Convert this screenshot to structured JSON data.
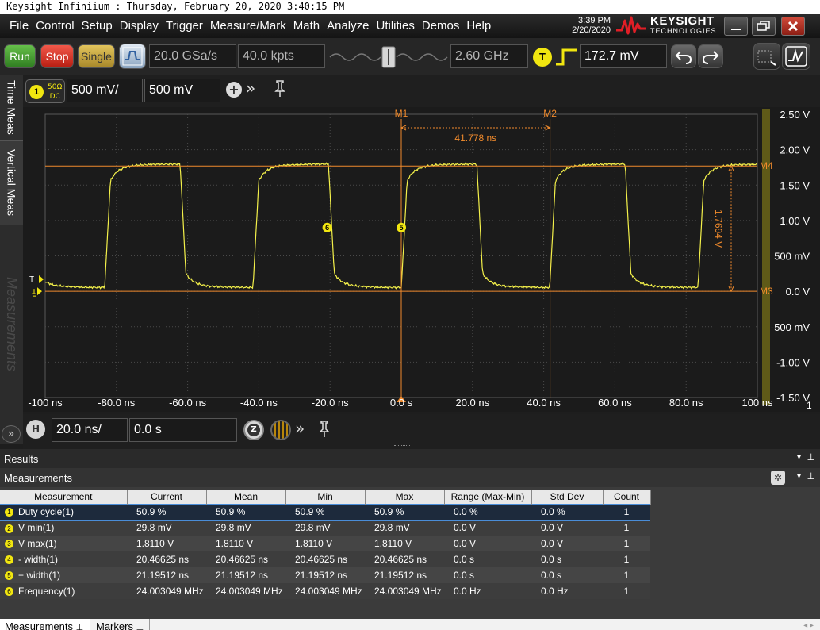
{
  "window_title": "Keysight Infiniium : Thursday, February 20, 2020 3:40:15 PM",
  "menu": [
    "File",
    "Control",
    "Setup",
    "Display",
    "Trigger",
    "Measure/Mark",
    "Math",
    "Analyze",
    "Utilities",
    "Demos",
    "Help"
  ],
  "clock": {
    "time": "3:39 PM",
    "date": "2/20/2020"
  },
  "brand": {
    "name": "KEYSIGHT",
    "sub": "TECHNOLOGIES"
  },
  "toolbar": {
    "run": "Run",
    "stop": "Stop",
    "single": "Single",
    "sample_rate": "20.0 GSa/s",
    "memory_depth": "40.0 kpts",
    "bandwidth": "2.60 GHz",
    "trigger_badge": "T",
    "trigger_level": "172.7 mV"
  },
  "side_tabs": [
    "Time Meas",
    "Vertical Meas",
    "Measurements"
  ],
  "channel": {
    "number": "1",
    "coupling_top": "50Ω",
    "coupling_bottom": "DC",
    "scale": "500 mV/",
    "offset": "500 mV"
  },
  "horizontal": {
    "badge": "H",
    "scale": "20.0 ns/",
    "position": "0.0 s",
    "zoom_badge": "Z"
  },
  "colors": {
    "trace": "#f3f04a",
    "marker": "#f08a2c",
    "grid": "#4a4a4a",
    "channel": "#f1e610"
  },
  "chart_data": {
    "type": "line",
    "x_unit": "ns",
    "xlim": [
      -100,
      100
    ],
    "ylim": [
      -1.5,
      2.5
    ],
    "x_ticks": [
      "-100 ns",
      "-80.0 ns",
      "-60.0 ns",
      "-40.0 ns",
      "-20.0 ns",
      "0.0 s",
      "20.0 ns",
      "40.0 ns",
      "60.0 ns",
      "80.0 ns",
      "100 ns"
    ],
    "y_ticks": [
      "2.50 V",
      "2.00 V",
      "1.50 V",
      "1.00 V",
      "500 mV",
      "0.0 V",
      "-500 mV",
      "-1.00 V",
      "-1.50 V"
    ],
    "signal": {
      "low_v": 0.05,
      "high_v": 1.8,
      "period_ns": 41.66,
      "rise_start_ns": -83.3,
      "rise_ns": 1.6,
      "fall_ns": 1.6,
      "high_ns": 21.2
    },
    "markers": {
      "M1": {
        "x": 0.0
      },
      "M2": {
        "x": 41.778
      },
      "M3": {
        "y": 0.0
      },
      "M4": {
        "y": 1.7694
      },
      "dx_label": "41.778 ns",
      "dy_label": "1.7694 V"
    },
    "measure_points": [
      {
        "id": "6",
        "x": -20.8,
        "y": 0.9
      },
      {
        "id": "5",
        "x": 0.0,
        "y": 0.9
      }
    ],
    "trigger_label": "T",
    "right_edge_label": "1"
  },
  "results": {
    "panel_title": "Results",
    "section_title": "Measurements",
    "columns": [
      "Measurement",
      "Current",
      "Mean",
      "Min",
      "Max",
      "Range (Max-Min)",
      "Std Dev",
      "Count"
    ],
    "rows": [
      {
        "n": "1",
        "cells": [
          "Duty cycle(1)",
          "50.9 %",
          "50.9 %",
          "50.9 %",
          "50.9 %",
          "0.0 %",
          "0.0 %",
          "1"
        ]
      },
      {
        "n": "2",
        "cells": [
          "V min(1)",
          "29.8 mV",
          "29.8 mV",
          "29.8 mV",
          "29.8 mV",
          "0.0 V",
          "0.0 V",
          "1"
        ]
      },
      {
        "n": "3",
        "cells": [
          "V max(1)",
          "1.8110 V",
          "1.8110 V",
          "1.8110 V",
          "1.8110 V",
          "0.0 V",
          "0.0 V",
          "1"
        ]
      },
      {
        "n": "4",
        "cells": [
          "- width(1)",
          "20.46625 ns",
          "20.46625 ns",
          "20.46625 ns",
          "20.46625 ns",
          "0.0 s",
          "0.0 s",
          "1"
        ]
      },
      {
        "n": "5",
        "cells": [
          "+ width(1)",
          "21.19512 ns",
          "21.19512 ns",
          "21.19512 ns",
          "21.19512 ns",
          "0.0 s",
          "0.0 s",
          "1"
        ]
      },
      {
        "n": "6",
        "cells": [
          "Frequency(1)",
          "24.003049 MHz",
          "24.003049 MHz",
          "24.003049 MHz",
          "24.003049 MHz",
          "0.0 Hz",
          "0.0 Hz",
          "1"
        ]
      }
    ],
    "bottom_tabs": [
      "Measurements",
      "Markers"
    ]
  }
}
